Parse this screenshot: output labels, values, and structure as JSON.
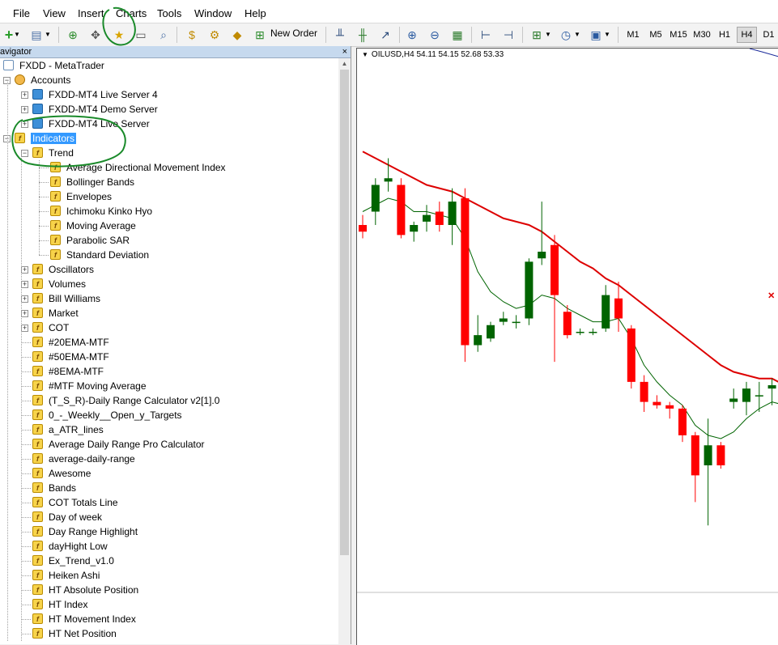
{
  "menu": [
    "File",
    "View",
    "Insert",
    "Charts",
    "Tools",
    "Window",
    "Help"
  ],
  "toolbar": {
    "new_order_label": "New Order",
    "timeframes": [
      "M1",
      "M5",
      "M15",
      "M30",
      "H1",
      "H4",
      "D1"
    ],
    "active_timeframe": "H4"
  },
  "navigator": {
    "title": "avigator",
    "close": "×",
    "tree": [
      {
        "label": "FXDD - MetaTrader",
        "level": 0,
        "icon": "metatrader-icon"
      },
      {
        "label": "Accounts",
        "level": 1,
        "icon": "accounts-icon",
        "expander": "minus"
      },
      {
        "label": "FXDD-MT4 Live Server 4",
        "level": 2,
        "icon": "server-icon",
        "expander": "plus"
      },
      {
        "label": "FXDD-MT4 Demo Server",
        "level": 2,
        "icon": "server-icon",
        "expander": "plus"
      },
      {
        "label": "FXDD-MT4 Live Server",
        "level": 2,
        "icon": "server-icon",
        "expander": "plus"
      },
      {
        "label": "Indicators",
        "level": 1,
        "icon": "indicators-icon",
        "expander": "minus",
        "selected": true
      },
      {
        "label": "Trend",
        "level": 2,
        "icon": "indicator-folder-icon",
        "expander": "minus"
      },
      {
        "label": "Average Directional Movement Index",
        "level": 3,
        "icon": "indicator-icon"
      },
      {
        "label": "Bollinger Bands",
        "level": 3,
        "icon": "indicator-icon"
      },
      {
        "label": "Envelopes",
        "level": 3,
        "icon": "indicator-icon"
      },
      {
        "label": "Ichimoku Kinko Hyo",
        "level": 3,
        "icon": "indicator-icon"
      },
      {
        "label": "Moving Average",
        "level": 3,
        "icon": "indicator-icon"
      },
      {
        "label": "Parabolic SAR",
        "level": 3,
        "icon": "indicator-icon"
      },
      {
        "label": "Standard Deviation",
        "level": 3,
        "icon": "indicator-icon"
      },
      {
        "label": "Oscillators",
        "level": 2,
        "icon": "indicator-folder-icon",
        "expander": "plus"
      },
      {
        "label": "Volumes",
        "level": 2,
        "icon": "indicator-folder-icon",
        "expander": "plus"
      },
      {
        "label": "Bill Williams",
        "level": 2,
        "icon": "indicator-folder-icon",
        "expander": "plus"
      },
      {
        "label": "Market",
        "level": 2,
        "icon": "market-icon",
        "expander": "plus"
      },
      {
        "label": "COT",
        "level": 2,
        "icon": "custom-indicator-icon",
        "expander": "plus"
      },
      {
        "label": "#20EMA-MTF",
        "level": 2,
        "icon": "custom-indicator-icon"
      },
      {
        "label": "#50EMA-MTF",
        "level": 2,
        "icon": "custom-indicator-icon"
      },
      {
        "label": "#8EMA-MTF",
        "level": 2,
        "icon": "custom-indicator-icon"
      },
      {
        "label": "#MTF Moving Average",
        "level": 2,
        "icon": "custom-indicator-icon"
      },
      {
        "label": "(T_S_R)-Daily Range Calculator v2[1].0",
        "level": 2,
        "icon": "custom-indicator-icon"
      },
      {
        "label": "0_-_Weekly__Open_y_Targets",
        "level": 2,
        "icon": "custom-indicator-icon"
      },
      {
        "label": "a_ATR_lines",
        "level": 2,
        "icon": "custom-indicator-icon"
      },
      {
        "label": "Average Daily Range Pro Calculator",
        "level": 2,
        "icon": "custom-indicator-icon"
      },
      {
        "label": "average-daily-range",
        "level": 2,
        "icon": "custom-indicator-icon"
      },
      {
        "label": "Awesome",
        "level": 2,
        "icon": "custom-indicator-icon"
      },
      {
        "label": "Bands",
        "level": 2,
        "icon": "custom-indicator-icon"
      },
      {
        "label": "COT Totals Line",
        "level": 2,
        "icon": "custom-indicator-icon"
      },
      {
        "label": "Day of week",
        "level": 2,
        "icon": "custom-indicator-icon"
      },
      {
        "label": "Day Range Highlight",
        "level": 2,
        "icon": "custom-indicator-icon"
      },
      {
        "label": "dayHight Low",
        "level": 2,
        "icon": "custom-indicator-icon"
      },
      {
        "label": "Ex_Trend_v1.0",
        "level": 2,
        "icon": "custom-indicator-icon"
      },
      {
        "label": "Heiken Ashi",
        "level": 2,
        "icon": "custom-indicator-icon"
      },
      {
        "label": "HT Absolute Position",
        "level": 2,
        "icon": "custom-indicator-icon"
      },
      {
        "label": "HT Index",
        "level": 2,
        "icon": "custom-indicator-icon"
      },
      {
        "label": "HT Movement Index",
        "level": 2,
        "icon": "custom-indicator-icon"
      },
      {
        "label": "HT Net Position",
        "level": 2,
        "icon": "custom-indicator-icon"
      }
    ]
  },
  "chart": {
    "label": "OILUSD,H4  54.11 54.15 52.68 53.33",
    "colors": {
      "bull": "#006400",
      "bear": "#ff0000",
      "ma_fast": "#006400",
      "ma_slow": "#dd0000"
    }
  },
  "chart_data": {
    "type": "candlestick",
    "symbol": "OILUSD",
    "timeframe": "H4",
    "last_ohlc": [
      54.11,
      54.15,
      52.68,
      53.33
    ],
    "candles": [
      {
        "o": 56.6,
        "h": 56.75,
        "l": 56.4,
        "c": 56.5
      },
      {
        "o": 56.8,
        "h": 57.3,
        "l": 56.6,
        "c": 57.2
      },
      {
        "o": 57.25,
        "h": 57.6,
        "l": 57.1,
        "c": 57.3
      },
      {
        "o": 57.2,
        "h": 57.3,
        "l": 56.4,
        "c": 56.45
      },
      {
        "o": 56.5,
        "h": 56.65,
        "l": 56.35,
        "c": 56.6
      },
      {
        "o": 56.65,
        "h": 56.9,
        "l": 56.5,
        "c": 56.75
      },
      {
        "o": 56.8,
        "h": 56.95,
        "l": 56.5,
        "c": 56.6
      },
      {
        "o": 56.6,
        "h": 57.15,
        "l": 56.3,
        "c": 56.95
      },
      {
        "o": 57.0,
        "h": 57.15,
        "l": 54.55,
        "c": 54.8
      },
      {
        "o": 54.8,
        "h": 55.25,
        "l": 54.7,
        "c": 54.95
      },
      {
        "o": 54.9,
        "h": 55.15,
        "l": 54.85,
        "c": 55.1
      },
      {
        "o": 55.15,
        "h": 55.3,
        "l": 55.1,
        "c": 55.2
      },
      {
        "o": 55.15,
        "h": 55.25,
        "l": 55.05,
        "c": 55.15
      },
      {
        "o": 55.2,
        "h": 56.1,
        "l": 55.1,
        "c": 56.05
      },
      {
        "o": 56.1,
        "h": 56.95,
        "l": 56.0,
        "c": 56.2
      },
      {
        "o": 56.3,
        "h": 56.45,
        "l": 54.55,
        "c": 55.55
      },
      {
        "o": 55.3,
        "h": 55.4,
        "l": 54.9,
        "c": 54.95
      },
      {
        "o": 55.0,
        "h": 55.05,
        "l": 54.95,
        "c": 55.0
      },
      {
        "o": 55.0,
        "h": 55.05,
        "l": 54.95,
        "c": 55.0
      },
      {
        "o": 55.05,
        "h": 55.7,
        "l": 55.0,
        "c": 55.55
      },
      {
        "o": 55.5,
        "h": 55.75,
        "l": 55.0,
        "c": 55.2
      },
      {
        "o": 55.05,
        "h": 55.1,
        "l": 54.15,
        "c": 54.25
      },
      {
        "o": 54.25,
        "h": 54.35,
        "l": 53.8,
        "c": 53.95
      },
      {
        "o": 53.95,
        "h": 54.05,
        "l": 53.85,
        "c": 53.9
      },
      {
        "o": 53.9,
        "h": 53.95,
        "l": 53.7,
        "c": 53.85
      },
      {
        "o": 53.85,
        "h": 53.9,
        "l": 53.35,
        "c": 53.45
      },
      {
        "o": 53.45,
        "h": 53.5,
        "l": 52.45,
        "c": 52.85
      },
      {
        "o": 53.0,
        "h": 53.7,
        "l": 52.1,
        "c": 53.3
      },
      {
        "o": 53.3,
        "h": 53.35,
        "l": 52.95,
        "c": 53.0
      },
      {
        "o": 53.95,
        "h": 54.15,
        "l": 53.85,
        "c": 54.0
      },
      {
        "o": 53.95,
        "h": 54.25,
        "l": 53.75,
        "c": 54.15
      },
      {
        "o": 54.05,
        "h": 54.25,
        "l": 53.8,
        "c": 54.05
      },
      {
        "o": 54.15,
        "h": 54.3,
        "l": 53.9,
        "c": 54.2
      },
      {
        "o": 54.11,
        "h": 54.15,
        "l": 52.68,
        "c": 53.33
      }
    ],
    "ma_slow": [
      57.7,
      57.6,
      57.5,
      57.4,
      57.3,
      57.2,
      57.15,
      57.1,
      57.0,
      56.9,
      56.8,
      56.7,
      56.65,
      56.6,
      56.5,
      56.35,
      56.2,
      56.05,
      55.95,
      55.8,
      55.7,
      55.55,
      55.4,
      55.25,
      55.1,
      54.95,
      54.8,
      54.65,
      54.5,
      54.4,
      54.35,
      54.3,
      54.3,
      54.2
    ],
    "ma_fast": [
      56.8,
      56.9,
      57.0,
      56.95,
      56.8,
      56.8,
      56.75,
      56.7,
      56.4,
      55.9,
      55.6,
      55.45,
      55.35,
      55.4,
      55.55,
      55.5,
      55.35,
      55.25,
      55.15,
      55.15,
      55.2,
      54.9,
      54.5,
      54.25,
      54.05,
      53.9,
      53.6,
      53.45,
      53.4,
      53.5,
      53.7,
      53.85,
      53.95,
      53.9
    ],
    "y_range": [
      51.0,
      59.0
    ],
    "sell_marker": {
      "index": 32,
      "price": 55.55,
      "symbol": "×"
    }
  }
}
